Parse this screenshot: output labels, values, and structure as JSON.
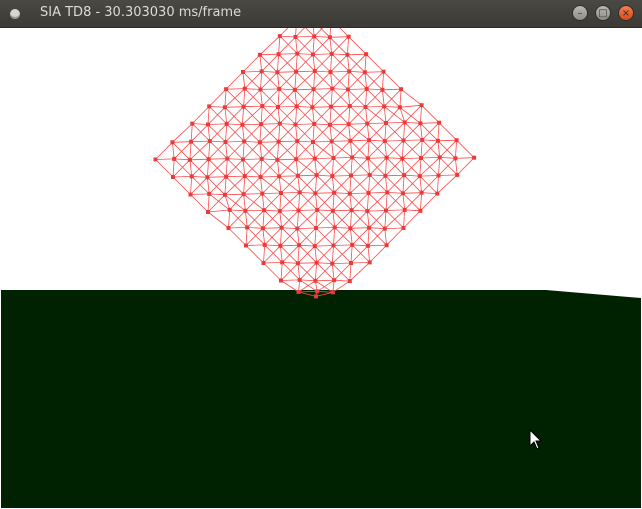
{
  "window": {
    "title": "SIA TD8 - 30.303030 ms/frame",
    "buttons": {
      "minimize_glyph": "–",
      "maximize_glyph": "□",
      "close_glyph": "×"
    }
  },
  "scene": {
    "sky_color": "#ffffff",
    "ground_color": "#002200",
    "mesh_color": "#ff4a4a",
    "node_color": "#e83c3c"
  }
}
